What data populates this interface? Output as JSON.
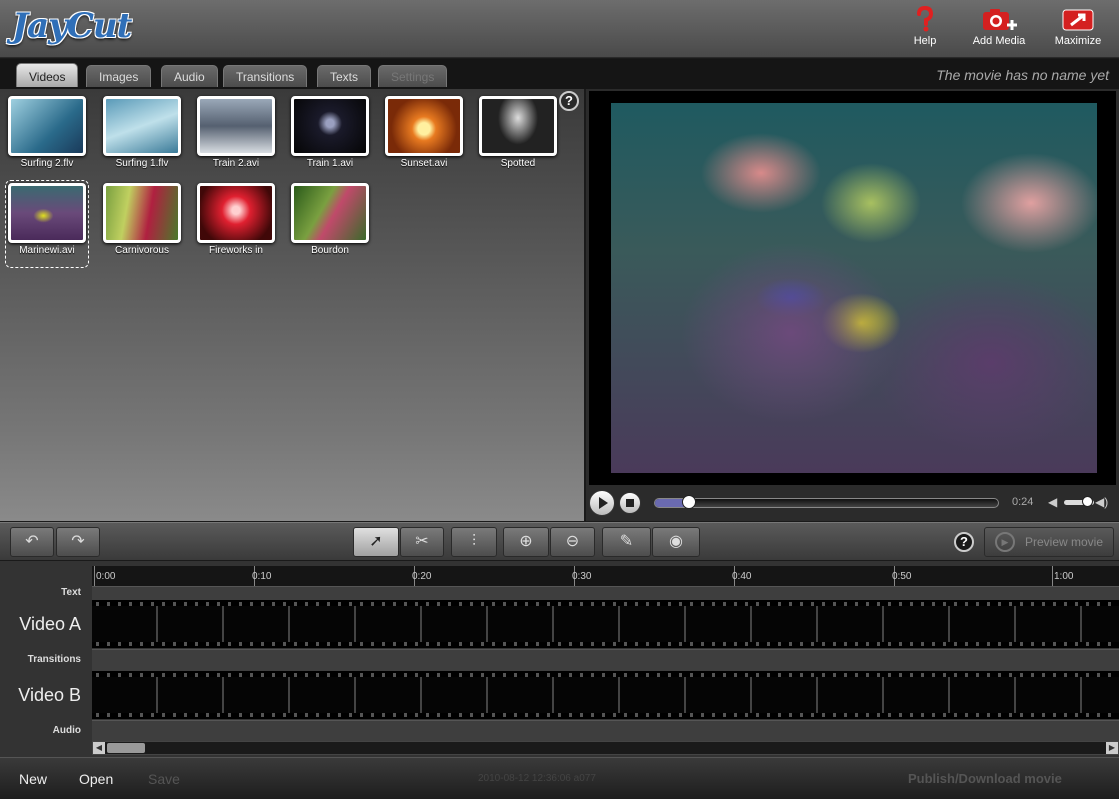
{
  "app": {
    "logo": "JayCut"
  },
  "header": {
    "help": {
      "label": "Help",
      "icon": "question-mark-icon"
    },
    "add_media": {
      "label": "Add Media",
      "icon": "camera-plus-icon"
    },
    "maximize": {
      "label": "Maximize",
      "icon": "maximize-arrow-icon"
    }
  },
  "tabs": [
    {
      "label": "Videos",
      "active": true
    },
    {
      "label": "Images"
    },
    {
      "label": "Audio"
    },
    {
      "label": "Transitions"
    },
    {
      "label": "Texts"
    },
    {
      "label": "Settings",
      "disabled": true
    }
  ],
  "movie_name": "The movie has no name yet",
  "media": [
    {
      "name": "Surfing 2.flv",
      "color": "#4a8fa8"
    },
    {
      "name": "Surfing 1.flv",
      "color": "#5aa0c0"
    },
    {
      "name": "Train 2.avi",
      "color": "#8a9aa8"
    },
    {
      "name": "Train 1.avi",
      "color": "#1a1a2a"
    },
    {
      "name": "Sunset.avi",
      "color": "#c8601a"
    },
    {
      "name": "Spotted",
      "color": "#222222"
    },
    {
      "name": "Marinewi.avi",
      "color": "#6a4a7a",
      "selected": true
    },
    {
      "name": "Carnivorous",
      "color": "#6a8a3a"
    },
    {
      "name": "Fireworks in",
      "color": "#b01a2a"
    },
    {
      "name": "Bourdon",
      "color": "#3a7a2a"
    }
  ],
  "player": {
    "timecode": "0:24",
    "progress": 0.1,
    "volume": 0.75,
    "play_icon": "play-icon",
    "stop_icon": "stop-icon"
  },
  "toolbar": {
    "undo_icon": "↶",
    "redo_icon": "↷",
    "select_icon": "➚",
    "cut_icon": "✂",
    "mixer_icon": "⫶",
    "zoom_in_icon": "⊕",
    "zoom_out_icon": "⊖",
    "mic_icon": "✎",
    "webcam_icon": "◉",
    "help": "?",
    "preview_movie": "Preview movie"
  },
  "timeline": {
    "ticks": [
      "0:00",
      "0:10",
      "0:20",
      "0:30",
      "0:40",
      "0:50",
      "1:00"
    ],
    "tracks": {
      "text": "Text",
      "video_a": "Video A",
      "transitions": "Transitions",
      "video_b": "Video B",
      "audio": "Audio"
    }
  },
  "footer": {
    "new": "New",
    "open": "Open",
    "save": "Save",
    "stamp": "2010-08-12 12:36:06 a077",
    "publish": "Publish/Download movie"
  }
}
